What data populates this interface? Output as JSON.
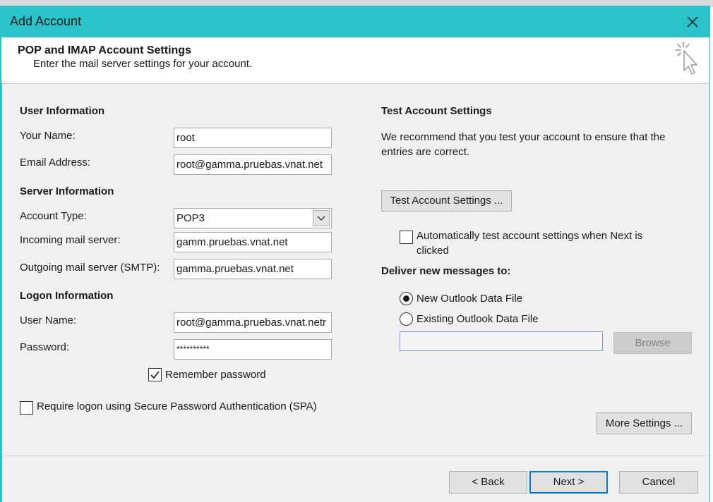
{
  "window": {
    "title": "Add Account"
  },
  "header": {
    "title": "POP and IMAP Account Settings",
    "subtitle": "Enter the mail server settings for your account."
  },
  "user_info": {
    "heading": "User Information",
    "name_label": "Your Name:",
    "name_value": "root",
    "email_label": "Email Address:",
    "email_value": "root@gamma.pruebas.vnat.net"
  },
  "server_info": {
    "heading": "Server Information",
    "account_type_label": "Account Type:",
    "account_type_value": "POP3",
    "incoming_label": "Incoming mail server:",
    "incoming_value": "gamm.pruebas.vnat.net",
    "outgoing_label": "Outgoing mail server (SMTP):",
    "outgoing_value": "gamma.pruebas.vnat.net"
  },
  "logon_info": {
    "heading": "Logon Information",
    "username_label": "User Name:",
    "username_value": "root@gamma.pruebas.vnat.netr",
    "password_label": "Password:",
    "password_value": "**********",
    "remember_label": "Remember password",
    "remember_checked": true,
    "spa_label": "Require logon using Secure Password Authentication (SPA)",
    "spa_checked": false
  },
  "test_settings": {
    "heading": "Test Account Settings",
    "description": "We recommend that you test your account to ensure that the entries are correct.",
    "button_label": "Test Account Settings ...",
    "auto_test_label_line1": "Automatically test account settings when Next is",
    "auto_test_label_line2": "clicked",
    "auto_test_checked": false
  },
  "deliver": {
    "heading": "Deliver new messages to:",
    "option_new": "New Outlook Data File",
    "option_existing": "Existing Outlook Data File",
    "selected": "New Outlook Data File",
    "path_value": "",
    "browse_label": "Browse"
  },
  "buttons": {
    "more_settings": "More Settings ...",
    "back": "< Back",
    "next": "Next >",
    "cancel": "Cancel"
  },
  "colors": {
    "titlebar": "#2bc3ca",
    "primary_border": "#0078d7"
  },
  "icons": {
    "close": "close-icon",
    "header_graphic": "cursor-click-icon",
    "dropdown": "chevron-down-icon",
    "check": "check-icon"
  }
}
